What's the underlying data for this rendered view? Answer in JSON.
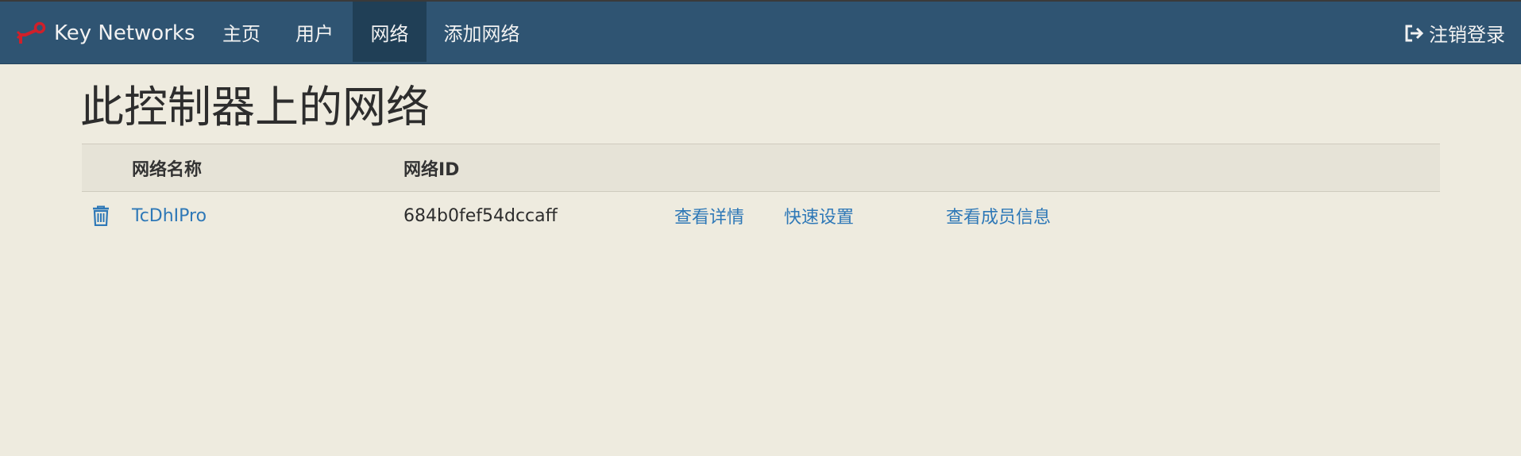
{
  "nav": {
    "brand": "Key Networks",
    "items": [
      {
        "label": "主页"
      },
      {
        "label": "用户"
      },
      {
        "label": "网络"
      },
      {
        "label": "添加网络"
      }
    ],
    "logout": "注销登录"
  },
  "main": {
    "title": "此控制器上的网络",
    "table": {
      "headers": {
        "name": "网络名称",
        "id": "网络ID"
      },
      "rows": [
        {
          "name": "TcDhIPro",
          "id": "684b0fef54dccaff",
          "details": "查看详情",
          "quick_setup": "快速设置",
          "members": "查看成员信息"
        }
      ]
    }
  },
  "colors": {
    "navbar": "#2f5472",
    "nav_active": "#203f56",
    "background": "#eeebdf",
    "link": "#2e78b7",
    "logo": "#d0202a"
  },
  "icons": {
    "brand": "key-logo-icon",
    "logout": "sign-out-icon",
    "delete": "trash-icon"
  }
}
